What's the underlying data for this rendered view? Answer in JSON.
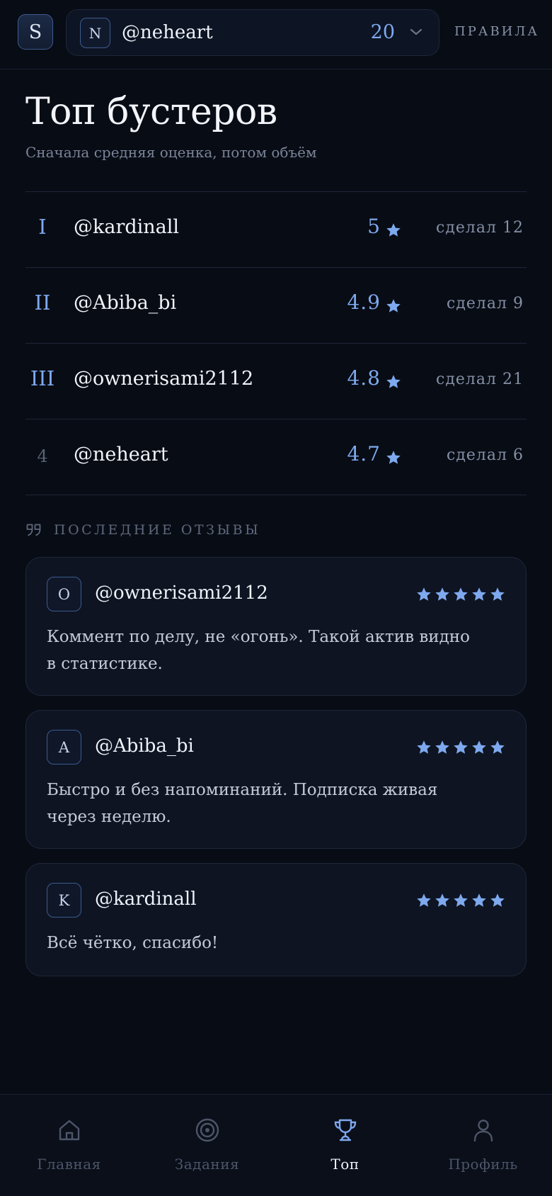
{
  "header": {
    "app_initial": "S",
    "account": {
      "initial": "N",
      "name": "@neheart",
      "count": "20"
    },
    "rules_label": "ПРАВИЛА"
  },
  "title": "Топ бустеров",
  "subtitle": "Сначала средняя оценка, потом объём",
  "ranking": [
    {
      "pos": "I",
      "name": "@kardinall",
      "score": "5",
      "done": "сделал 12"
    },
    {
      "pos": "II",
      "name": "@Abiba_bi",
      "score": "4.9",
      "done": "сделал 9"
    },
    {
      "pos": "III",
      "name": "@ownerisami2112",
      "score": "4.8",
      "done": "сделал 21"
    },
    {
      "pos": "4",
      "name": "@neheart",
      "score": "4.7",
      "done": "сделал 6"
    }
  ],
  "reviews_title": "ПОСЛЕДНИЕ ОТЗЫВЫ",
  "reviews": [
    {
      "initial": "O",
      "name": "@ownerisami2112",
      "stars": 5,
      "text": "Коммент по делу, не «огонь». Такой актив видно в статистике."
    },
    {
      "initial": "A",
      "name": "@Abiba_bi",
      "stars": 5,
      "text": "Быстро и без напоминаний. Подписка живая через неделю."
    },
    {
      "initial": "K",
      "name": "@kardinall",
      "stars": 5,
      "text": "Всё чётко, спасибо!"
    }
  ],
  "nav": [
    {
      "label": "Главная",
      "icon": "home-icon",
      "active": false
    },
    {
      "label": "Задания",
      "icon": "target-icon",
      "active": false
    },
    {
      "label": "Топ",
      "icon": "trophy-icon",
      "active": true
    },
    {
      "label": "Профиль",
      "icon": "user-icon",
      "active": false
    }
  ],
  "colors": {
    "background": "#080c15",
    "accent": "#7ea9ee",
    "card": "#0e1422",
    "muted": "#5f687c"
  }
}
